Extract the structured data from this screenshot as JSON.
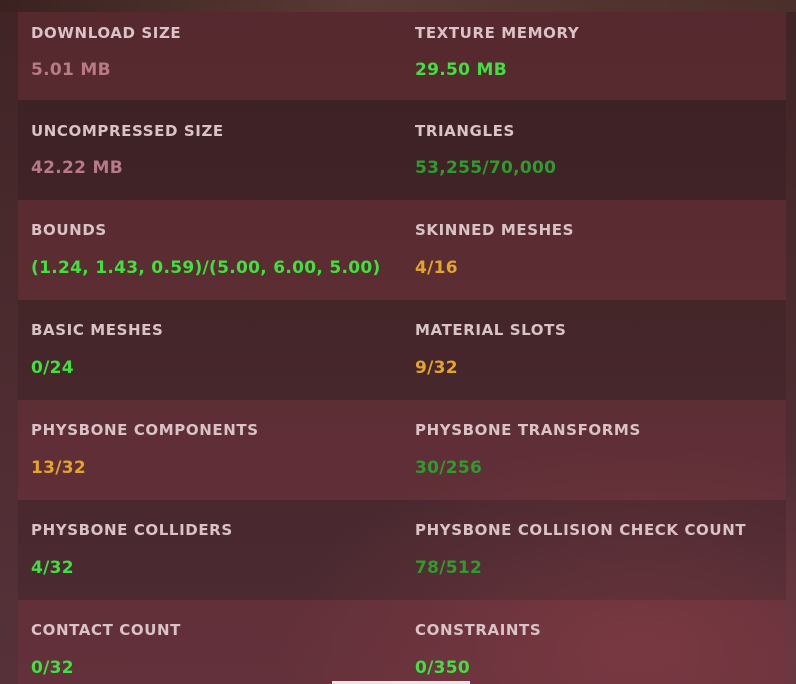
{
  "stats": [
    {
      "label": "DOWNLOAD SIZE",
      "value": "5.01 MB",
      "color": "#b77a86"
    },
    {
      "label": "TEXTURE MEMORY",
      "value": "29.50 MB",
      "color": "#3fe03f"
    },
    {
      "label": "UNCOMPRESSED SIZE",
      "value": "42.22 MB",
      "color": "#b77a86"
    },
    {
      "label": "TRIANGLES",
      "value": "53,255/70,000",
      "color": "#2f9b2f"
    },
    {
      "label": "BOUNDS",
      "value": "(1.24, 1.43, 0.59)/(5.00, 6.00, 5.00)",
      "color": "#3fe03f"
    },
    {
      "label": "SKINNED MESHES",
      "value": "4/16",
      "color": "#e2a52c"
    },
    {
      "label": "BASIC MESHES",
      "value": "0/24",
      "color": "#3fe03f"
    },
    {
      "label": "MATERIAL SLOTS",
      "value": "9/32",
      "color": "#e2a52c"
    },
    {
      "label": "PHYSBONE COMPONENTS",
      "value": "13/32",
      "color": "#e2a52c"
    },
    {
      "label": "PHYSBONE TRANSFORMS",
      "value": "30/256",
      "color": "#2f9b2f"
    },
    {
      "label": "PHYSBONE COLLIDERS",
      "value": "4/32",
      "color": "#3fe03f"
    },
    {
      "label": "PHYSBONE COLLISION CHECK COUNT",
      "value": "78/512",
      "color": "#2f9b2f"
    },
    {
      "label": "CONTACT COUNT",
      "value": "0/32",
      "color": "#3fe03f"
    },
    {
      "label": "CONSTRAINTS",
      "value": "0/350",
      "color": "#3fe03f"
    }
  ]
}
